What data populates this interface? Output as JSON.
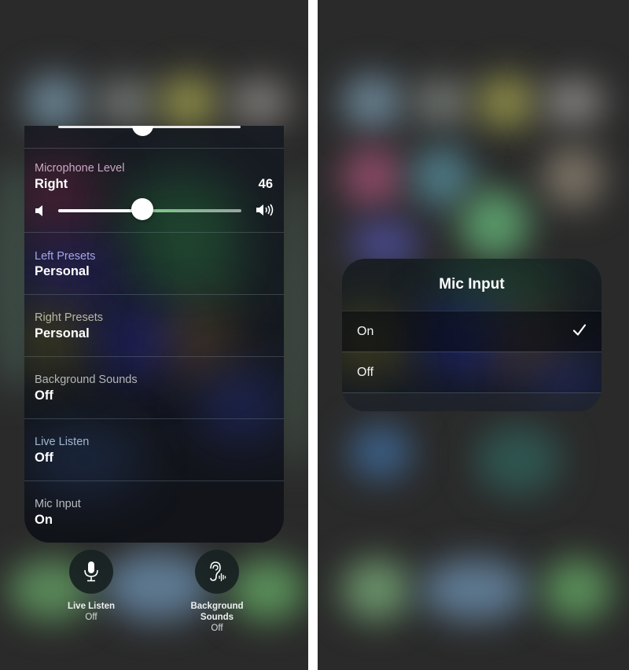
{
  "left_screen": {
    "microphone_level": {
      "label": "Microphone Level",
      "side": "Right",
      "value": "46",
      "slider_fraction": 0.46,
      "low_volume_icon": "speaker-low-icon",
      "high_volume_icon": "speaker-high-icon"
    },
    "rows": [
      {
        "label": "Left Presets",
        "value": "Personal"
      },
      {
        "label": "Right Presets",
        "value": "Personal"
      },
      {
        "label": "Background Sounds",
        "value": "Off"
      },
      {
        "label": "Live Listen",
        "value": "Off"
      },
      {
        "label": "Mic Input",
        "value": "On"
      }
    ],
    "bottom_buttons": [
      {
        "icon": "microphone-icon",
        "title": "Live Listen",
        "status": "Off"
      },
      {
        "icon": "ear-sound-icon",
        "title": "Background Sounds",
        "status": "Off"
      }
    ],
    "colors": {
      "slider_fill": "#ffffff",
      "slider_remaining": "#7ccc86"
    }
  },
  "right_screen": {
    "popup": {
      "title": "Mic Input",
      "options": [
        {
          "label": "On",
          "selected": true
        },
        {
          "label": "Off",
          "selected": false
        }
      ],
      "check_icon": "checkmark-icon"
    }
  }
}
